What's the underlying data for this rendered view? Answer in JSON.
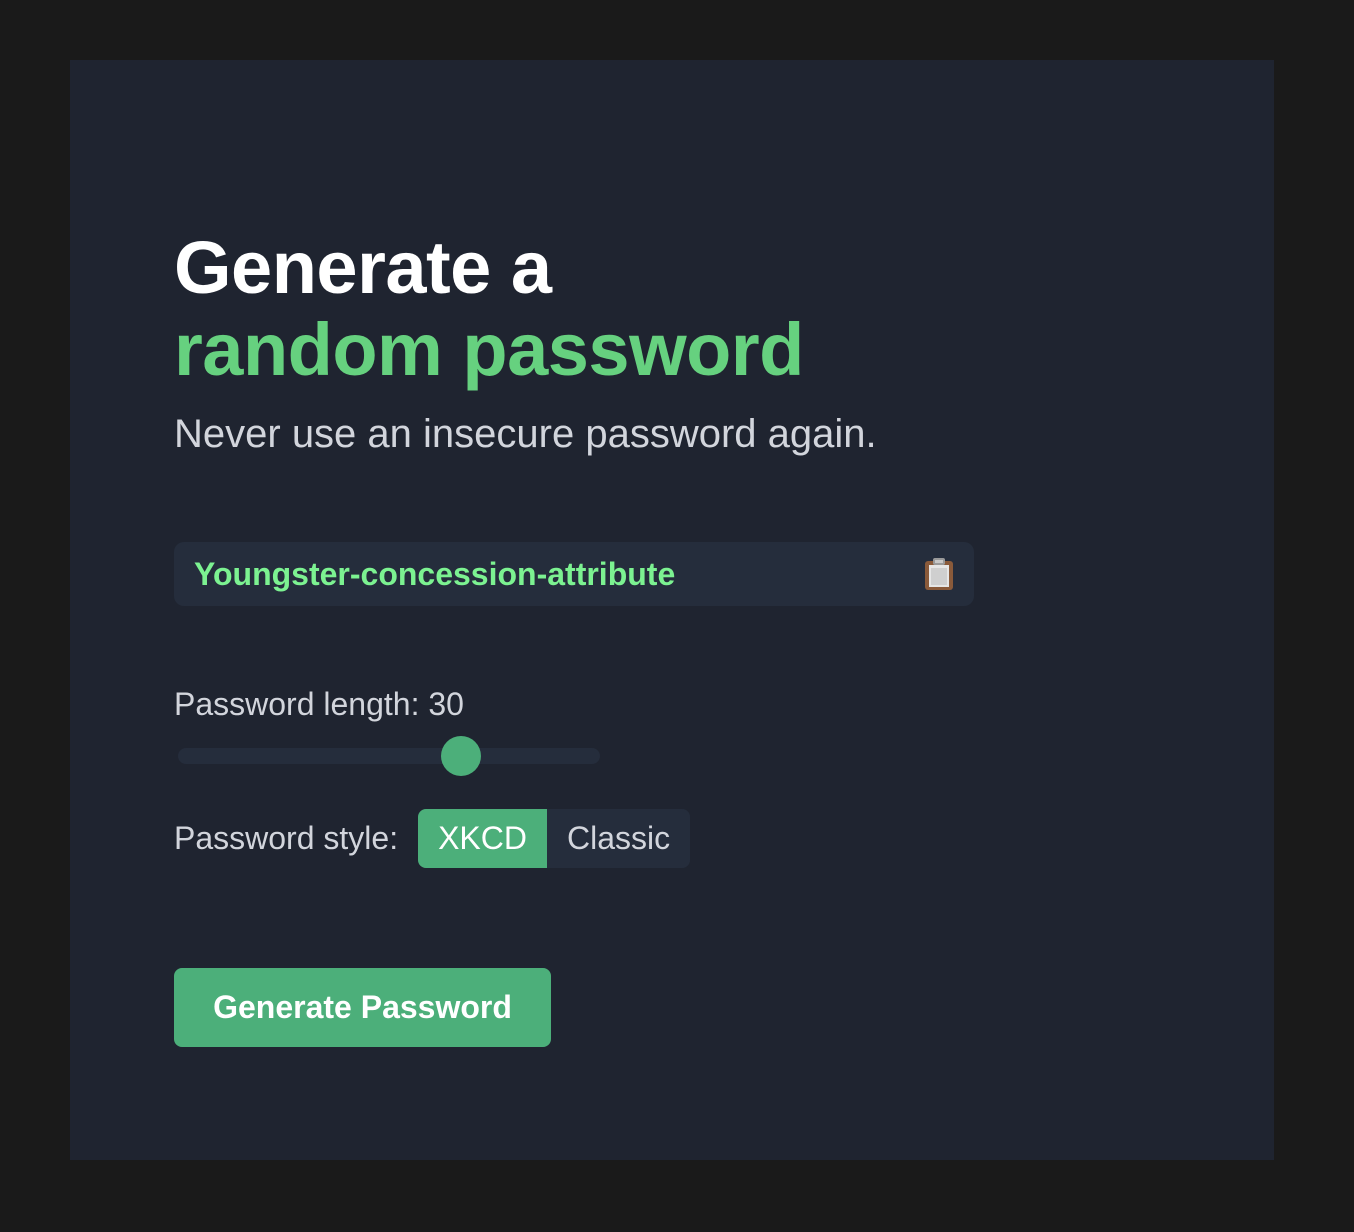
{
  "colors": {
    "page_bg": "#1a1a1a",
    "panel_bg": "#1f2430",
    "field_bg": "#252d3c",
    "accent": "#4caf7a",
    "accent_text": "#66d17f",
    "password_text": "#7cf291",
    "muted_text": "#d2d5dc",
    "white": "#ffffff"
  },
  "heading": {
    "line1": "Generate a",
    "line2": "random password"
  },
  "subtitle": "Never use an insecure password again.",
  "password": {
    "value": "Youngster-concession-attribute",
    "copy_icon": "clipboard-icon"
  },
  "length": {
    "label": "Password length: 30",
    "value": 30,
    "slider_fraction": 0.67
  },
  "style": {
    "label": "Password style:",
    "options": [
      "XKCD",
      "Classic"
    ],
    "selected": "XKCD"
  },
  "generate_button": {
    "label": "Generate Password"
  }
}
